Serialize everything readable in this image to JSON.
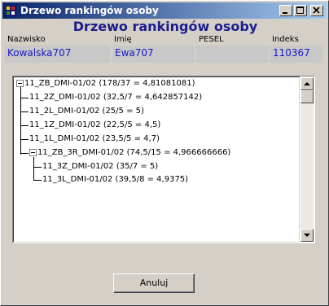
{
  "window": {
    "title": "Drzewo rankingów osoby"
  },
  "heading": "Drzewo rankingów osoby",
  "fields": [
    {
      "label": "Nazwisko",
      "value": "Kowalska707"
    },
    {
      "label": "Imię",
      "value": "Ewa707"
    },
    {
      "label": "PESEL",
      "value": ""
    },
    {
      "label": "Indeks",
      "value": "110367"
    }
  ],
  "tree": {
    "nodes": [
      {
        "label": "11_ZB_DMI-01/02 (178/37 = 4,81081081)",
        "level": 0,
        "expanded": true
      },
      {
        "label": "11_2Z_DMI-01/02 (32,5/7 = 4,642857142)",
        "level": 1
      },
      {
        "label": "11_2L_DMI-01/02 (25/5 = 5)",
        "level": 1
      },
      {
        "label": "11_1Z_DMI-01/02 (22,5/5 = 4,5)",
        "level": 1
      },
      {
        "label": "11_1L_DMI-01/02 (23,5/5 = 4,7)",
        "level": 1
      },
      {
        "label": "11_ZB_3R_DMI-01/02 (74,5/15 = 4,966666666)",
        "level": 1,
        "expanded": true
      },
      {
        "label": "11_3Z_DMI-01/02 (35/7 = 5)",
        "level": 2
      },
      {
        "label": "11_3L_DMI-01/02 (39,5/8 = 4,9375)",
        "level": 2
      }
    ]
  },
  "buttons": {
    "cancel": "Anuluj"
  },
  "colors": {
    "title_gradient_start": "#0a246a",
    "title_gradient_end": "#a6caf0",
    "heading": "#1c1c8c",
    "field_value": "#1616c8"
  }
}
